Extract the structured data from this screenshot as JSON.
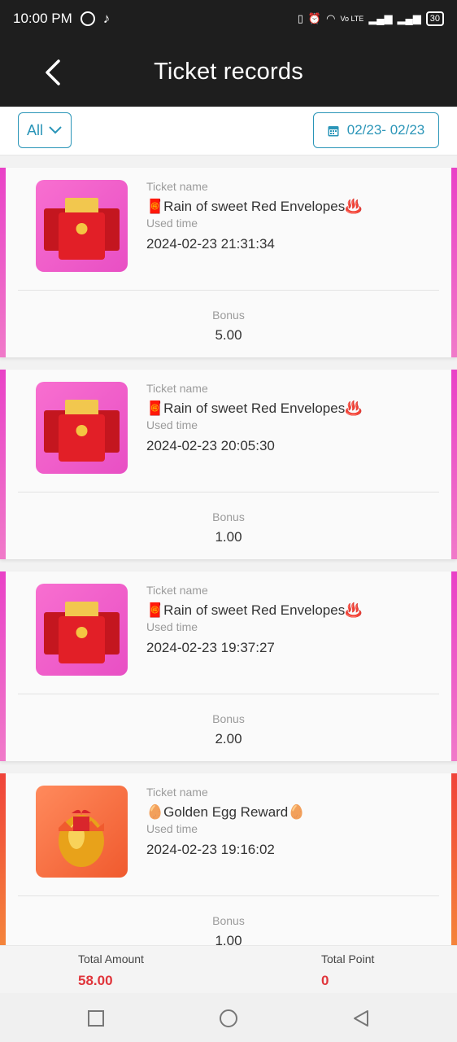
{
  "status_bar": {
    "time": "10:00 PM",
    "network": "Vo LTE",
    "battery": "30"
  },
  "header": {
    "title": "Ticket records"
  },
  "filters": {
    "type_label": "All",
    "date_range": "02/23- 02/23"
  },
  "records": [
    {
      "ticket_name_label": "Ticket name",
      "ticket_name_prefix": "🧧",
      "ticket_name": "Rain of sweet Red Envelopes",
      "ticket_name_suffix": "♨️",
      "used_time_label": "Used time",
      "used_time": "2024-02-23 21:31:34",
      "bonus_label": "Bonus",
      "bonus": "5.00",
      "theme": "pink",
      "icon": "red-envelopes-icon"
    },
    {
      "ticket_name_label": "Ticket name",
      "ticket_name_prefix": "🧧",
      "ticket_name": "Rain of sweet Red Envelopes",
      "ticket_name_suffix": "♨️",
      "used_time_label": "Used time",
      "used_time": "2024-02-23 20:05:30",
      "bonus_label": "Bonus",
      "bonus": "1.00",
      "theme": "pink",
      "icon": "red-envelopes-icon"
    },
    {
      "ticket_name_label": "Ticket name",
      "ticket_name_prefix": "🧧",
      "ticket_name": "Rain of sweet Red Envelopes",
      "ticket_name_suffix": "♨️",
      "used_time_label": "Used time",
      "used_time": "2024-02-23 19:37:27",
      "bonus_label": "Bonus",
      "bonus": "2.00",
      "theme": "pink",
      "icon": "red-envelopes-icon"
    },
    {
      "ticket_name_label": "Ticket name",
      "ticket_name_prefix": "🥚",
      "ticket_name": "Golden Egg Reward",
      "ticket_name_suffix": "🥚",
      "used_time_label": "Used time",
      "used_time": "2024-02-23 19:16:02",
      "bonus_label": "Bonus",
      "bonus": "1.00",
      "theme": "orange",
      "icon": "golden-egg-icon"
    }
  ],
  "footer": {
    "total_amount_label": "Total Amount",
    "total_amount": "58.00",
    "total_point_label": "Total Point",
    "total_point": "0"
  },
  "colors": {
    "accent": "#2a95b8",
    "header_bg": "#1e1e1e",
    "total_value": "#e0353b",
    "pink_stripe": "#e941c7",
    "orange_stripe": "#f0433a"
  }
}
